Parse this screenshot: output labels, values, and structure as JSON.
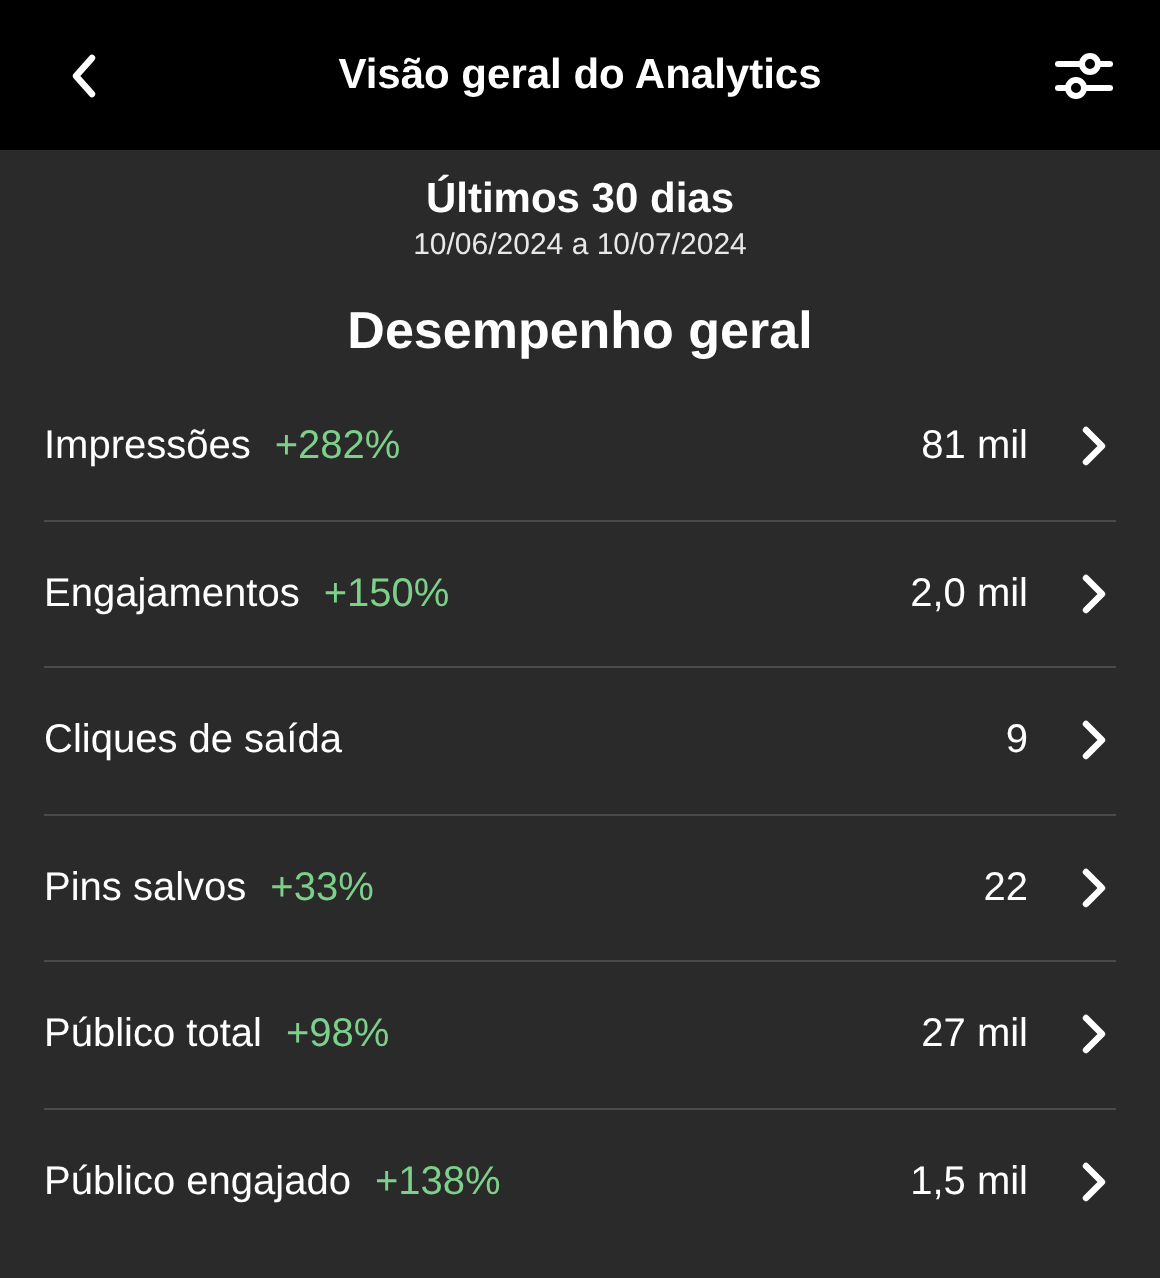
{
  "header": {
    "title": "Visão geral do Analytics"
  },
  "period": {
    "title": "Últimos 30 dias",
    "range": "10/06/2024 a 10/07/2024"
  },
  "section_title": "Desempenho geral",
  "metrics": [
    {
      "label": "Impressões",
      "change": "+282%",
      "value": "81 mil"
    },
    {
      "label": "Engajamentos",
      "change": "+150%",
      "value": "2,0 mil"
    },
    {
      "label": "Cliques de saída",
      "value": "9"
    },
    {
      "label": "Pins salvos",
      "change": "+33%",
      "value": "22"
    },
    {
      "label": "Público total",
      "change": "+98%",
      "value": "27 mil"
    },
    {
      "label": "Público engajado",
      "change": "+138%",
      "value": "1,5 mil"
    }
  ]
}
